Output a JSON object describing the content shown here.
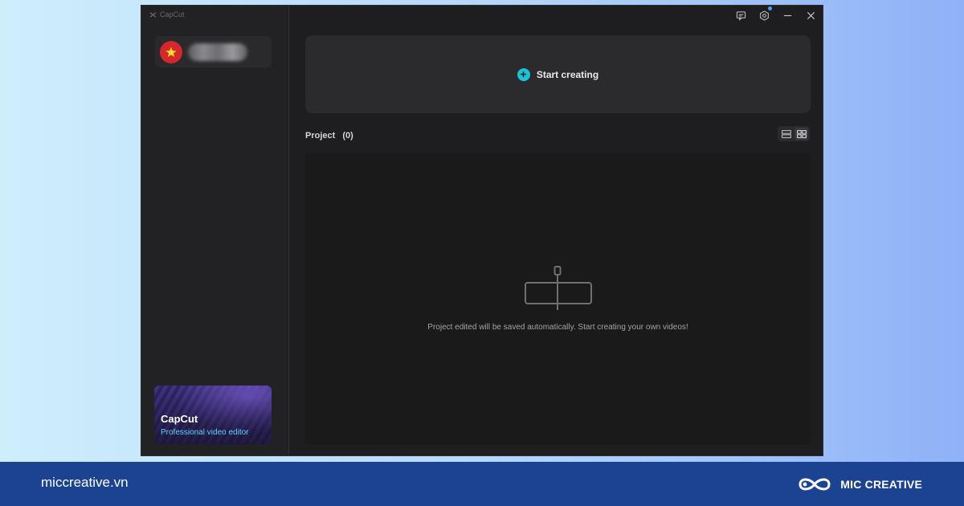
{
  "app": {
    "brand": "CapCut",
    "brand_icon": "capcut-logo-icon"
  },
  "sidebar": {
    "user": {
      "avatar_icon": "vietnam-flag-icon",
      "avatar_color": "#d8262d"
    },
    "promo": {
      "title": "CapCut",
      "subtitle": "Professional video editor"
    }
  },
  "topbar": {
    "icons": [
      "feedback-icon",
      "settings-icon",
      "minimize-icon",
      "close-icon"
    ],
    "notification_dot_color": "#3aa5ff"
  },
  "main": {
    "start_label": "Start creating",
    "start_icon": "plus-circle-icon",
    "accent": "#19c3d6",
    "project_label": "Project",
    "project_count": "(0)",
    "view_icons": [
      "list-view-icon",
      "grid-view-icon"
    ],
    "empty_text": "Project edited will be saved automatically. Start creating your own videos!"
  },
  "footer": {
    "site": "miccreative.vn",
    "logo_text": "MIC CREATIVE",
    "background": "#1c4292"
  }
}
